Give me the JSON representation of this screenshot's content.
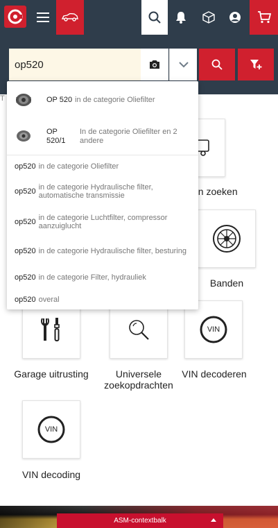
{
  "search": {
    "value": "op520",
    "placeholder": ""
  },
  "side_tab": {
    "label": "T"
  },
  "dropdown": {
    "products": [
      {
        "name": "OP 520",
        "category": "in de categorie Oliefilter"
      },
      {
        "name_line1": "OP",
        "name_line2": "520/1",
        "category": "In de categorie Oliefilter en 2 andere"
      }
    ],
    "suggestions": [
      {
        "term": "op520",
        "desc": "in de categorie Oliefilter"
      },
      {
        "term": "op520",
        "desc": "in de categorie Hydraulische filter, automatische transmissie"
      },
      {
        "term": "op520",
        "desc": "in de categorie Luchtfilter, compressor aanzuiglucht"
      },
      {
        "term": "op520",
        "desc": "in de categorie Hydraulische filter, besturing"
      },
      {
        "term": "op520",
        "desc": "in de categorie Filter, hydrauliek"
      },
      {
        "term": "op520",
        "desc": "overal"
      }
    ]
  },
  "tiles": {
    "truck_label_partial": "en zoeken",
    "tires_label": "Banden",
    "garage_label": "Garage uitrusting",
    "universal_label_1": "Universele",
    "universal_label_2": "zoekopdrachten",
    "vin_decoder_label": "VIN decoderen",
    "vin_decoding_label": "VIN decoding",
    "vin_icon_text": "VIN"
  },
  "context_bar": {
    "label": "ASM-contextbalk"
  },
  "colors": {
    "nav_bg": "#2f3d4b",
    "brand_red": "#d0202e",
    "input_bg": "#fdf7e6"
  },
  "icons": [
    "logo-icon",
    "menu-icon",
    "car-icon",
    "search-icon",
    "bell-icon",
    "box-icon",
    "user-icon",
    "cart-icon",
    "camera-icon",
    "chevron-down-icon",
    "filter-plus-icon",
    "oil-filter-icon",
    "truck-icon",
    "tire-icon",
    "tools-icon",
    "magnifier-icon",
    "vin-icon"
  ]
}
